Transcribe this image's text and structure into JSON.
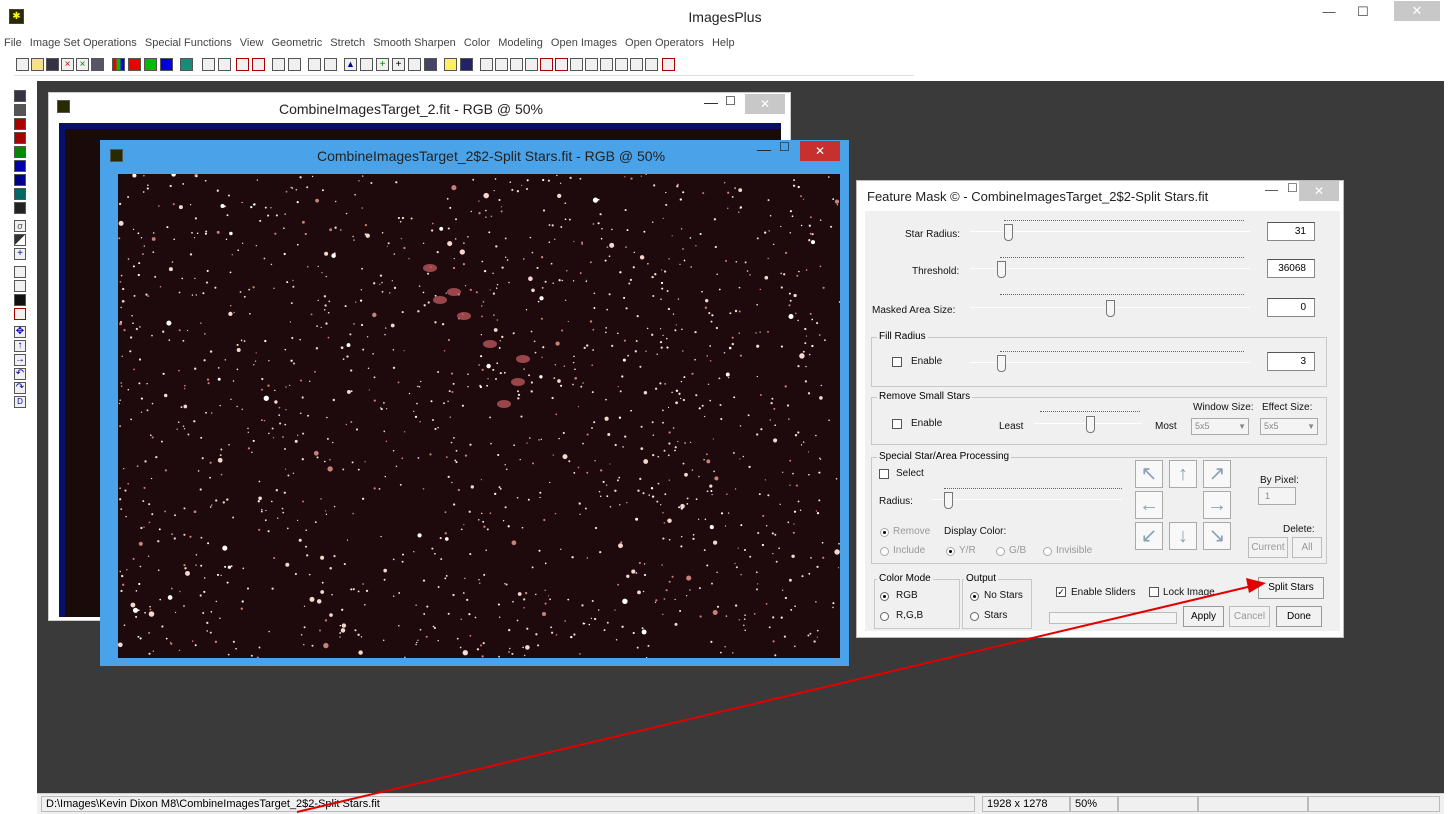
{
  "app": {
    "title": "ImagesPlus",
    "minimize": "—",
    "maximize": "☐",
    "close": "✕"
  },
  "menu": [
    "File",
    "Image Set Operations",
    "Special Functions",
    "View",
    "Geometric",
    "Stretch",
    "Smooth Sharpen",
    "Color",
    "Modeling",
    "Open Images",
    "Open Operators",
    "Help"
  ],
  "windows": {
    "back": {
      "title": "CombineImagesTarget_2.fit - RGB @ 50%"
    },
    "front": {
      "title": "CombineImagesTarget_2$2-Split Stars.fit - RGB @ 50%"
    }
  },
  "dialog": {
    "title": "Feature Mask © - CombineImagesTarget_2$2-Split Stars.fit",
    "star_radius": {
      "label": "Star Radius:",
      "value": "31"
    },
    "threshold": {
      "label": "Threshold:",
      "value": "36068"
    },
    "masked_area": {
      "label": "Masked Area Size:",
      "value": "0"
    },
    "fill_radius": {
      "group": "Fill Radius",
      "enable": "Enable",
      "value": "3"
    },
    "remove_small": {
      "group": "Remove Small Stars",
      "enable": "Enable",
      "least": "Least",
      "most": "Most",
      "window_size_label": "Window Size:",
      "effect_size_label": "Effect Size:",
      "window_size": "5x5",
      "effect_size": "5x5"
    },
    "special": {
      "group": "Special Star/Area Processing",
      "select": "Select",
      "radius": "Radius:",
      "remove": "Remove",
      "display_color": "Display Color:",
      "include": "Include",
      "yr": "Y/R",
      "gb": "G/B",
      "invisible": "Invisible",
      "by_pixel": "By Pixel:",
      "by_pixel_value": "1",
      "delete": "Delete:",
      "current": "Current",
      "all": "All",
      "arrows": [
        "↖",
        "↑",
        "↗",
        "←",
        "→",
        "↙",
        "↓",
        "↘"
      ]
    },
    "color_mode": {
      "group": "Color Mode",
      "rgb": "RGB",
      "rgb_sep": "R,G,B"
    },
    "output": {
      "group": "Output",
      "no_stars": "No Stars",
      "stars": "Stars"
    },
    "enable_sliders": "Enable Sliders",
    "lock_image": "Lock Image",
    "split_stars": "Split Stars",
    "apply": "Apply",
    "cancel": "Cancel",
    "done": "Done"
  },
  "status": {
    "path": "D:\\Images\\Kevin Dixon M8\\CombineImagesTarget_2$2-Split Stars.fit",
    "size": "1928 x 1278",
    "zoom": "50%"
  },
  "colors": {
    "active_title": "#4aa3e8",
    "close_red": "#c7302e",
    "mdi_bg": "#3a3a3a",
    "annotation_arrow": "#e00000"
  }
}
